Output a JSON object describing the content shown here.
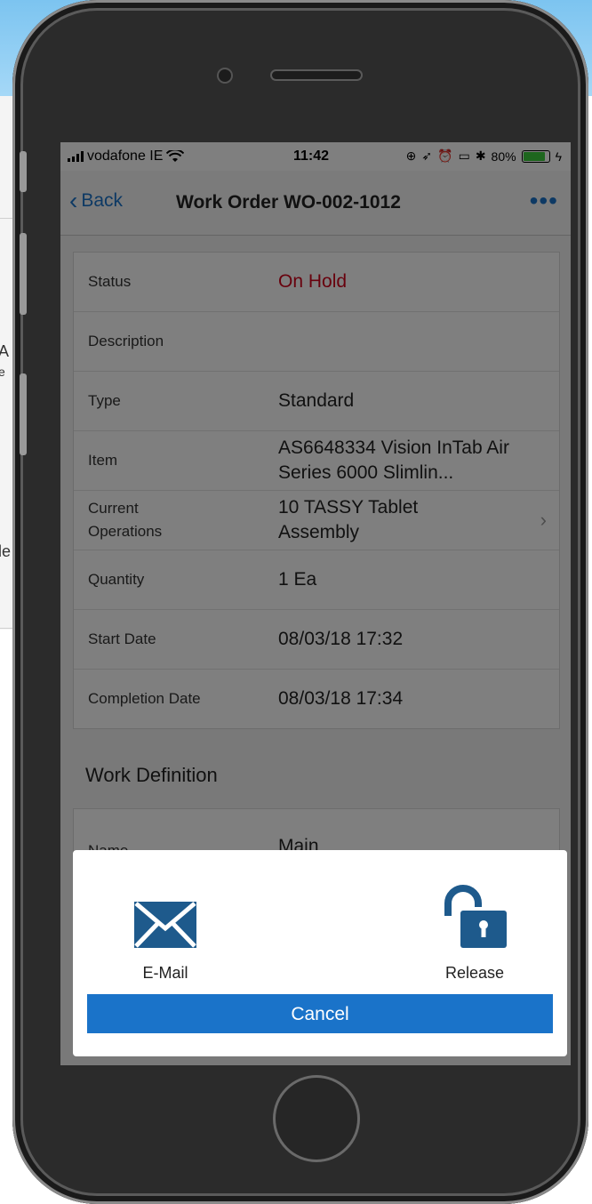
{
  "background": {
    "fragments": [
      "A",
      "e",
      "le"
    ]
  },
  "statusbar": {
    "carrier": "vodafone IE",
    "time": "11:42",
    "battery": "80%",
    "battery_level": 0.8
  },
  "navbar": {
    "back_label": "Back",
    "title": "Work Order WO-002-1012",
    "more_label": "•••"
  },
  "details": {
    "rows": [
      {
        "label": "Status",
        "value": "On Hold"
      },
      {
        "label": "Description",
        "value": ""
      },
      {
        "label": "Type",
        "value": "Standard"
      },
      {
        "label": "Item",
        "value": "AS6648334 Vision InTab Air Series 6000 Slimlin..."
      },
      {
        "label": "Current Operations",
        "value": "10 TASSY Tablet Assembly"
      },
      {
        "label": "Quantity",
        "value": "1 Ea"
      },
      {
        "label": "Start Date",
        "value": "08/03/18 17:32"
      },
      {
        "label": "Completion Date",
        "value": "08/03/18 17:34"
      }
    ]
  },
  "work_definition": {
    "title": "Work Definition",
    "name_label": "Name",
    "name_value": "Main"
  },
  "action_sheet": {
    "email_label": "E-Mail",
    "release_label": "Release",
    "cancel_label": "Cancel"
  },
  "colors": {
    "accent": "#1a73c9",
    "status_on_hold": "#d0021b"
  }
}
